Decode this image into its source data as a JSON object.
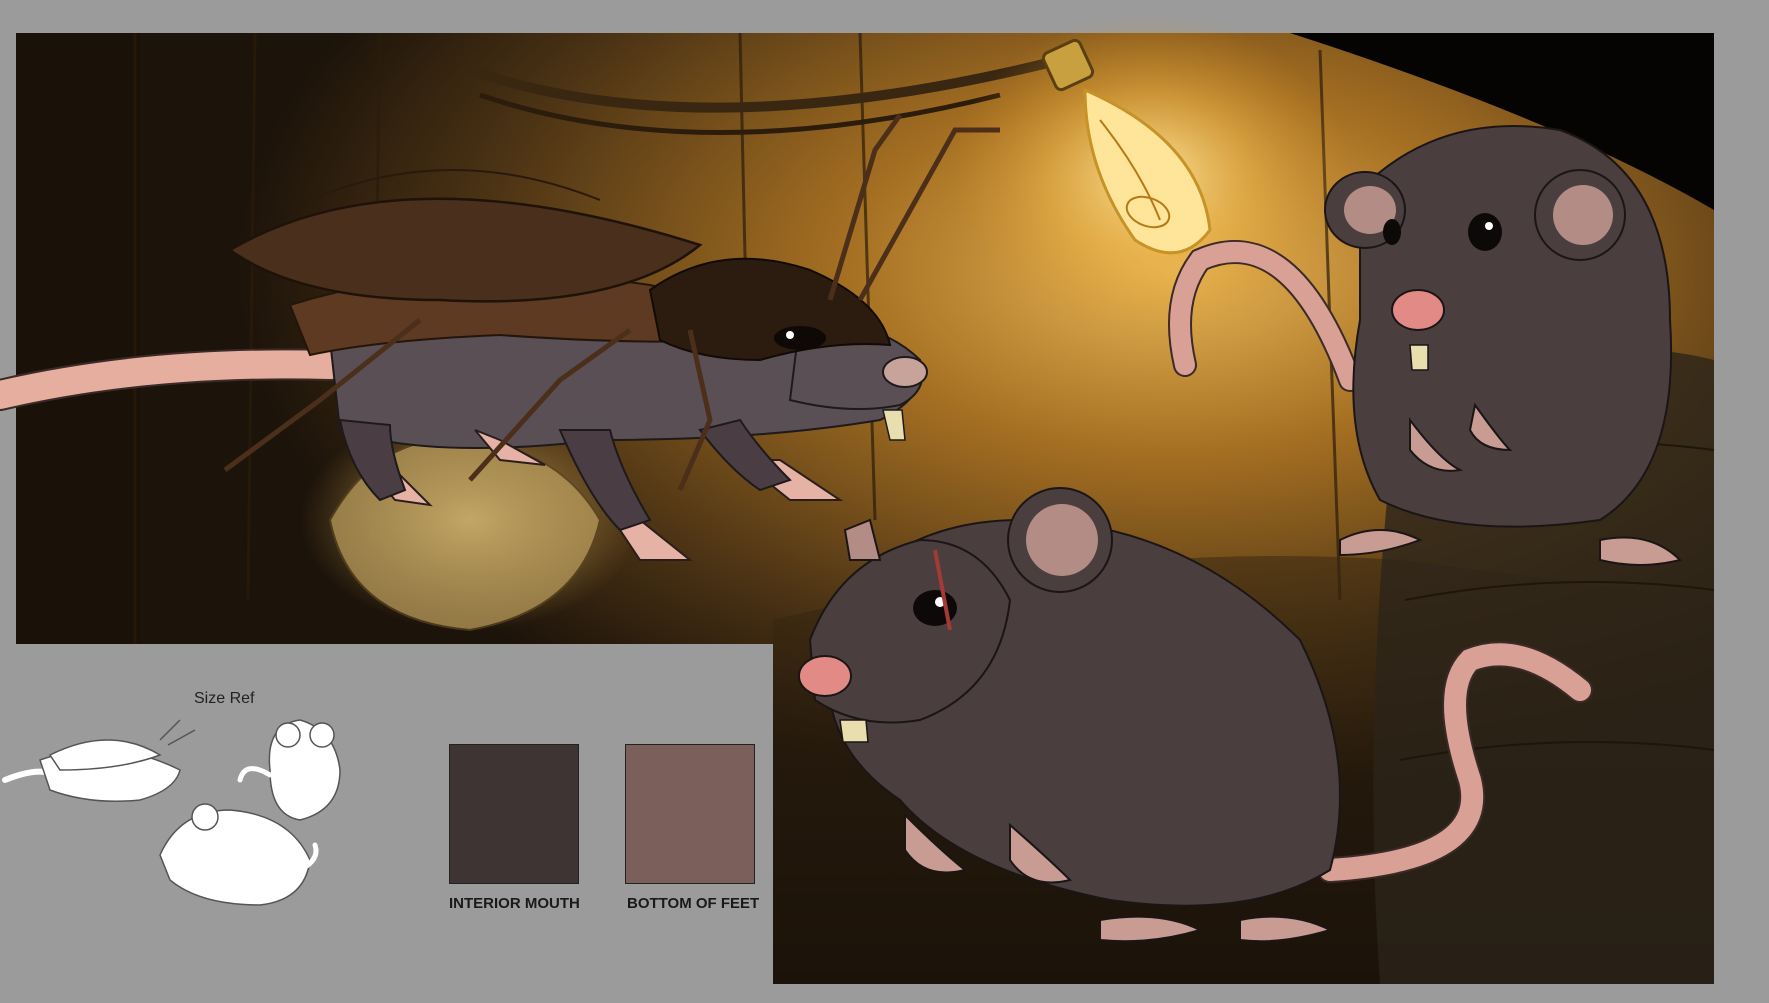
{
  "size_ref": {
    "label": "Size Ref"
  },
  "swatches": [
    {
      "label": "INTERIOR MOUTH",
      "color": "#3f3434"
    },
    {
      "label": "BOTTOM OF FEET",
      "color": "#7b5f5b"
    }
  ],
  "colors": {
    "canvas_bg": "#9b9b9b",
    "rat_fur": "#4a3e3f",
    "rat_ear_inner": "#b38c86",
    "rat_nose": "#e28a86",
    "tail_pink": "#d99a90",
    "cockroach_shell": "#4a2f1c",
    "bulb_glow": "#f3c766",
    "mouth_gum_red": "#8a1616",
    "mouth_tooth_cream": "#e9dfae",
    "mouth_tongue": "#e67a80"
  },
  "icons": [
    "light-bulb-icon",
    "cockroach-rat-figure",
    "rat-figure"
  ]
}
